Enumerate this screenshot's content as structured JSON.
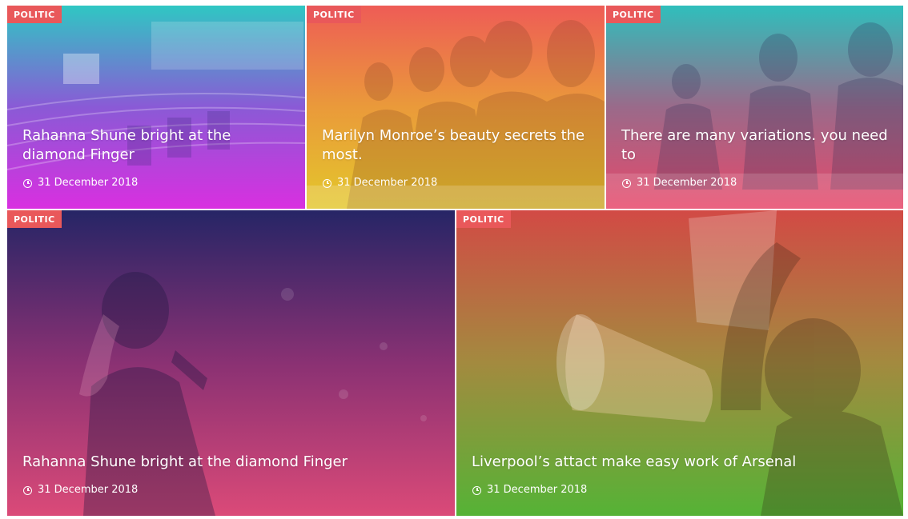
{
  "posts": [
    {
      "category": "POLITIC",
      "title": "Rahanna Shune bright at the diamond Finger",
      "date": "31 December 2018",
      "gradient": [
        "#2fc7c3",
        "#8a5ad6",
        "#d92fe0"
      ],
      "image": "conference-hall-image"
    },
    {
      "category": "POLITIC",
      "title": "Marilyn Monroe’s beauty secrets the most.",
      "date": "31 December 2018",
      "gradient": [
        "#ee5c56",
        "#ea9a3a",
        "#e3c72b"
      ],
      "image": "panel-speakers-image"
    },
    {
      "category": "POLITIC",
      "title": "There are many variations. you need to",
      "date": "31 December 2018",
      "gradient": [
        "#2fbfbc",
        "#9a6a8a",
        "#e8486a"
      ],
      "image": "meeting-men-image"
    },
    {
      "category": "POLITIC",
      "title": "Rahanna Shune bright at the diamond Finger",
      "date": "31 December 2018",
      "gradient": [
        "#262566",
        "#8a3173",
        "#db4a78"
      ],
      "image": "woman-microphone-image"
    },
    {
      "category": "POLITIC",
      "title": "Liverpool’s attact make easy work of Arsenal",
      "date": "31 December 2018",
      "gradient": [
        "#d24a45",
        "#a38a3f",
        "#55b336"
      ],
      "image": "megaphone-protest-image"
    }
  ]
}
